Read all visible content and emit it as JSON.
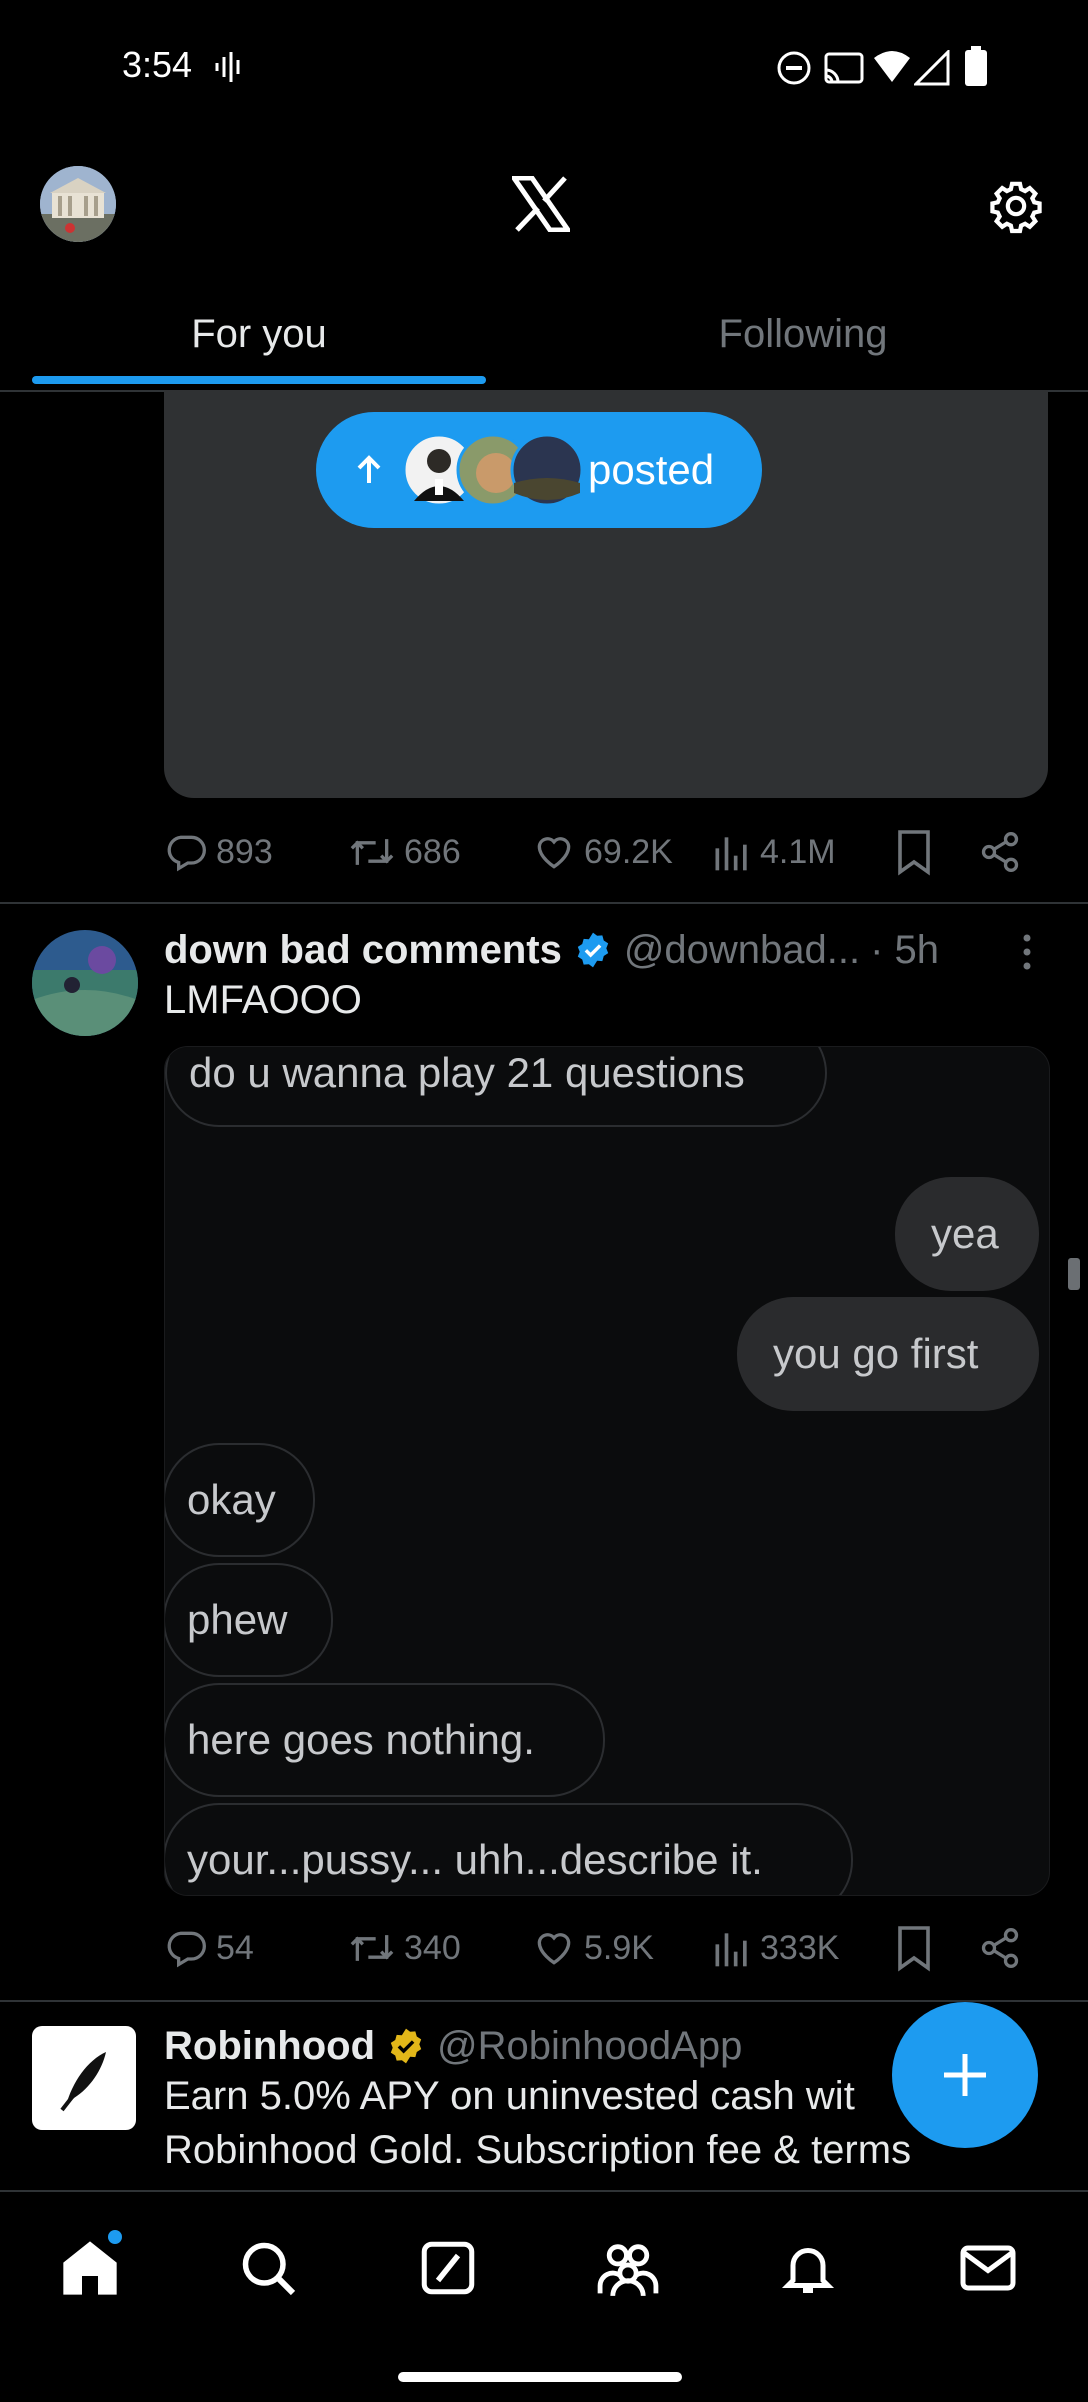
{
  "status": {
    "time": "3:54"
  },
  "tabs": [
    {
      "label": "For you",
      "active": true
    },
    {
      "label": "Following",
      "active": false
    }
  ],
  "new_posts_pill": {
    "label": "posted"
  },
  "post1_actions": {
    "replies": "893",
    "reposts": "686",
    "likes": "69.2K",
    "views": "4.1M"
  },
  "post2": {
    "name": "down bad comments",
    "handle": "@downbad...",
    "time": "· 5h",
    "text": "LMFAOOO",
    "messages": [
      {
        "side": "in",
        "text": "do u wanna play 21 questions"
      },
      {
        "side": "out",
        "text": "yea"
      },
      {
        "side": "out",
        "text": "you go first"
      },
      {
        "side": "in",
        "text": "okay"
      },
      {
        "side": "in",
        "text": "phew"
      },
      {
        "side": "in",
        "text": "here goes nothing."
      },
      {
        "side": "in",
        "text": "your...pussy... uhh...describe it."
      }
    ],
    "actions": {
      "replies": "54",
      "reposts": "340",
      "likes": "5.9K",
      "views": "333K"
    }
  },
  "post3": {
    "name": "Robinhood",
    "handle": "@RobinhoodApp",
    "text_line1": "Earn 5.0% APY on uninvested cash wit",
    "text_line2": "Robinhood Gold. Subscription fee & terms"
  },
  "colors": {
    "accent": "#1d9bf0",
    "verified_blue": "#1d9bf0",
    "verified_gold": "#e2b719"
  }
}
